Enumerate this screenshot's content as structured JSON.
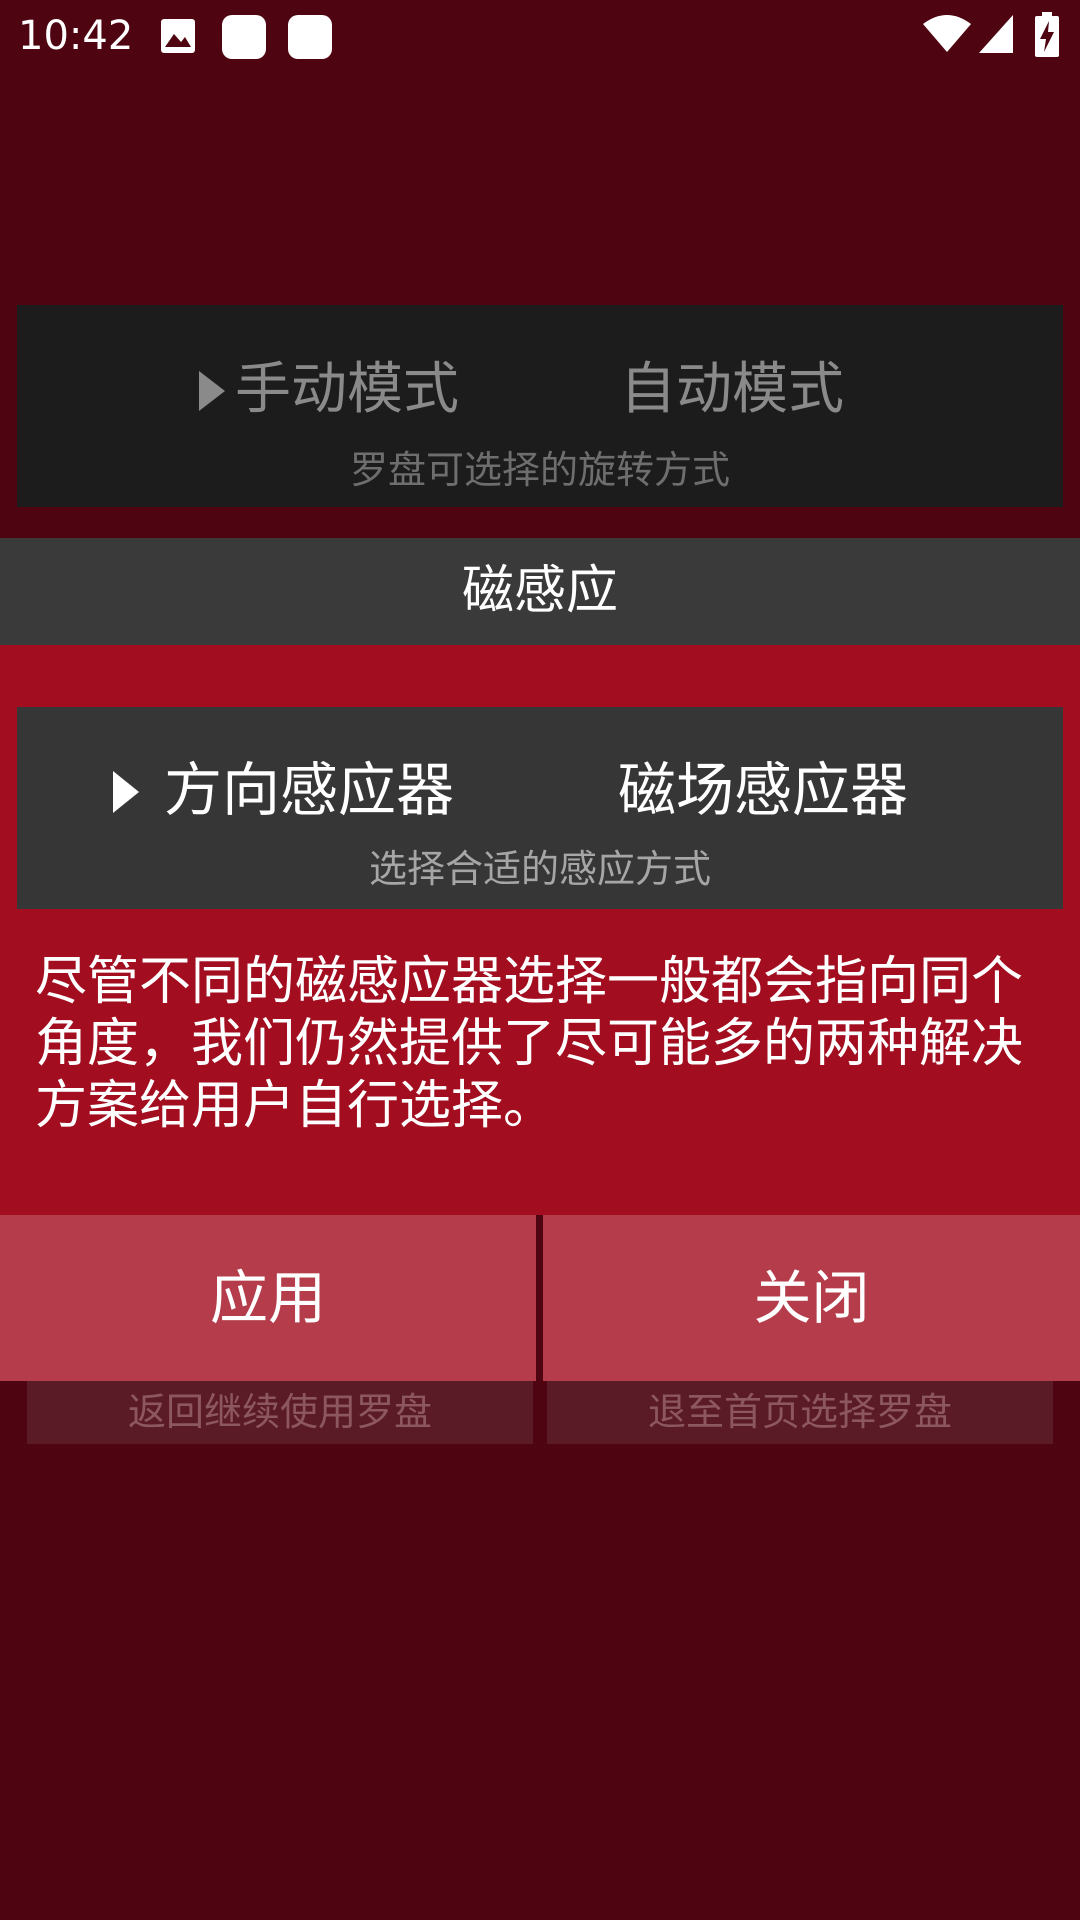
{
  "status_bar": {
    "time": "10:42",
    "icons": [
      "image-icon",
      "notification-square-icon",
      "notification-square-icon",
      "wifi-icon",
      "cellular-signal-icon",
      "battery-charging-icon"
    ]
  },
  "background": {
    "mode_options": [
      "手动模式",
      "自动模式"
    ],
    "mode_caption": "罗盘可选择的旋转方式",
    "bottom_captions": [
      "返回继续使用罗盘",
      "退至首页选择罗盘"
    ]
  },
  "dialog": {
    "title": "磁感应",
    "sensor_options": [
      "方向感应器",
      "磁场感应器"
    ],
    "sensor_caption": "选择合适的感应方式",
    "description": "尽管不同的磁感应器选择一般都会指向同个角度，我们仍然提供了尽可能多的两种解决方案给用户自行选择。",
    "apply_label": "应用",
    "close_label": "关闭"
  },
  "colors": {
    "page_background": "#4f0511",
    "dialog_body": "#a20d1f",
    "dialog_title_bar": "#3a3a3a",
    "dialog_button": "#b53d4b",
    "card": "#363636"
  }
}
